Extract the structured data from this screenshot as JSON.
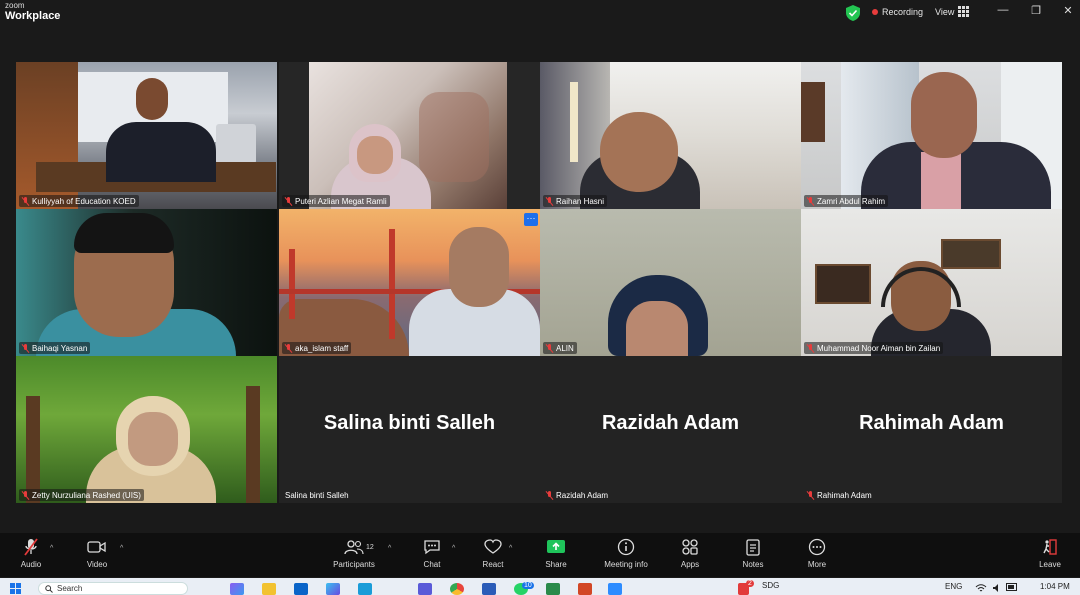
{
  "app": {
    "brand_small": "zoom",
    "brand_large": "Workplace"
  },
  "titlebar": {
    "recording_label": "Recording",
    "view_label": "View",
    "minimize": "—",
    "restore": "❐",
    "close": "✕"
  },
  "participants": [
    {
      "name": "Kulliyyah of Education KOED",
      "active": true
    },
    {
      "name": "Puteri Azlian Megat Ramli"
    },
    {
      "name": "Raihan Hasni"
    },
    {
      "name": "Zamri Abdul Rahim"
    },
    {
      "name": "Baihaqi Yasnan"
    },
    {
      "name": "aka_islam staff"
    },
    {
      "name": "ALIN"
    },
    {
      "name": "Muhammad Noor Aiman bin Zailan"
    },
    {
      "name": "Zetty Nurzuliana Rashed (UIS)"
    },
    {
      "name": "Salina binti Salleh",
      "display": "Salina binti Salleh"
    },
    {
      "name": "Razidah Adam",
      "display": "Razidah Adam"
    },
    {
      "name": "Rahimah Adam",
      "display": "Rahimah Adam"
    }
  ],
  "tile_more": "···",
  "controls": {
    "audio": "Audio",
    "video": "Video",
    "participants": "Participants",
    "participants_count": "12",
    "chat": "Chat",
    "react": "React",
    "share": "Share",
    "meeting_info": "Meeting info",
    "apps": "Apps",
    "notes": "Notes",
    "more": "More",
    "leave": "Leave"
  },
  "taskbar": {
    "search_placeholder": "Search",
    "badge_1": "10",
    "badge_2": "2",
    "sdg_label": "SDG",
    "lang": "ENG",
    "time": "1:04 PM"
  },
  "colors": {
    "active_border": "#23d959",
    "muted_red": "#e83c3c",
    "share_green": "#1fc45b",
    "leave_red": "#e23b3b",
    "tile_blue": "#1f6feb"
  }
}
